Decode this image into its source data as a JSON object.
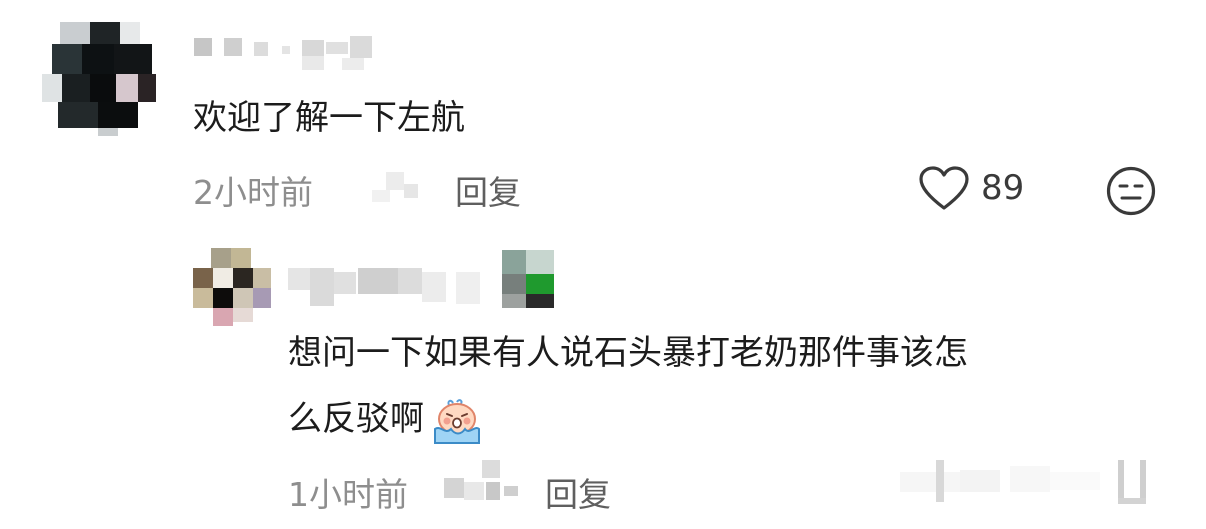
{
  "comments": [
    {
      "text": "欢迎了解一下左航",
      "time": "2小时前",
      "reply_label": "回复",
      "like_count": "89"
    },
    {
      "text_line1": "想问一下如果有人说石头暴打老奶那件事该怎",
      "text_line2": "么反驳啊",
      "emoji": "crying-face-emoji",
      "time": "1小时前",
      "reply_label": "回复"
    }
  ],
  "icons": {
    "like": "heart-outline-icon",
    "dislike": "neutral-face-icon"
  },
  "colors": {
    "meta_text": "#8e8e8e",
    "body_text": "#1c1c1c"
  }
}
